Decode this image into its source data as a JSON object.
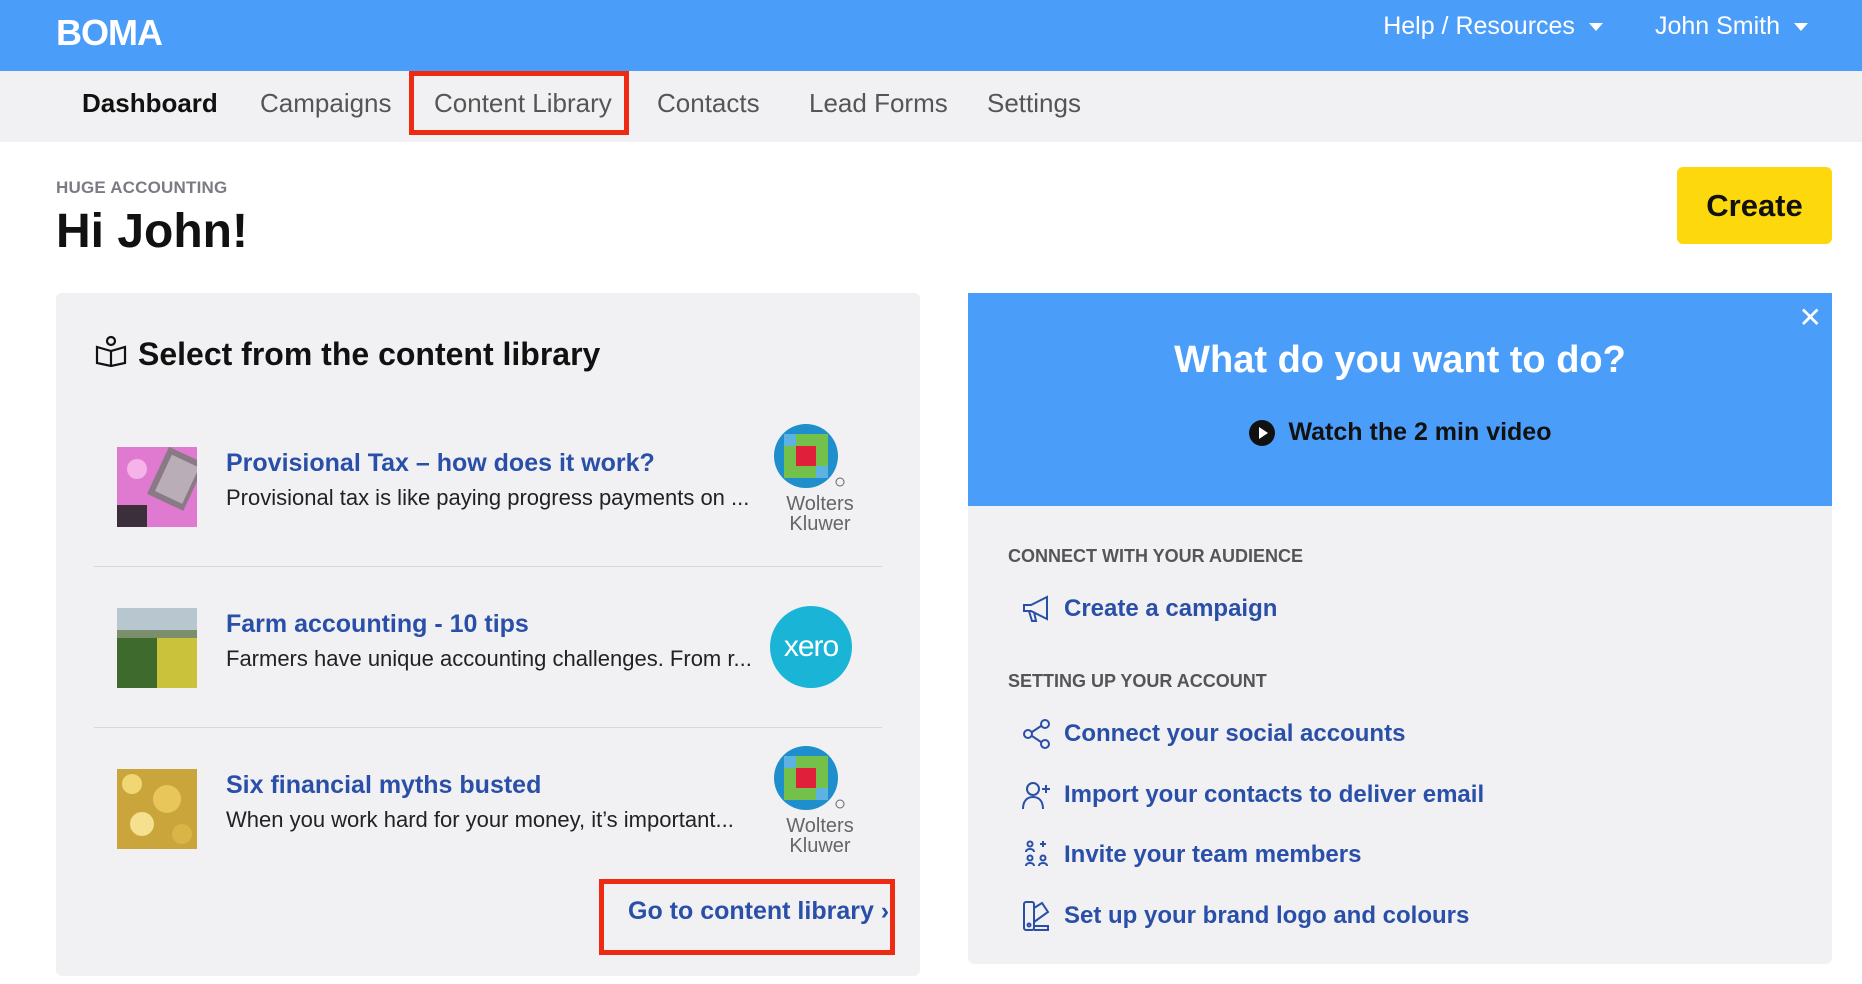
{
  "brand": "BOMA",
  "top_menu": {
    "help": "Help / Resources",
    "user": "John Smith"
  },
  "nav": {
    "tabs": [
      "Dashboard",
      "Campaigns",
      "Content Library",
      "Contacts",
      "Lead Forms",
      "Settings"
    ],
    "active": "Dashboard"
  },
  "header": {
    "org": "HUGE ACCOUNTING",
    "greeting": "Hi John!",
    "create": "Create"
  },
  "library": {
    "title": "Select from the content library",
    "items": [
      {
        "title": "Provisional Tax – how does it work?",
        "desc": "Provisional tax is like paying progress payments on ...",
        "source": "Wolters Kluwer",
        "source_label_1": "Wolters",
        "source_label_2": "Kluwer"
      },
      {
        "title": "Farm accounting - 10 tips",
        "desc": "Farmers have unique accounting challenges. From r...",
        "source": "xero"
      },
      {
        "title": "Six financial myths busted",
        "desc": "When you work hard for your money, it’s important...",
        "source": "Wolters Kluwer",
        "source_label_1": "Wolters",
        "source_label_2": "Kluwer"
      }
    ],
    "go_link": "Go to content library ›"
  },
  "todo": {
    "title": "What do you want to do?",
    "watch": "Watch the 2 min video",
    "section_connect": "CONNECT WITH YOUR AUDIENCE",
    "create_campaign": "Create a campaign",
    "section_setup": "SETTING UP YOUR ACCOUNT",
    "setup_actions": [
      "Connect your social accounts",
      "Import your contacts to deliver email",
      "Invite your team members",
      "Set up your brand logo and colours"
    ]
  },
  "colors": {
    "brand_blue": "#4a9efa",
    "link_blue": "#2a4fa8",
    "create_yellow": "#fcd80d",
    "highlight_red": "#ee2a12",
    "xero_blue": "#1ab4d7"
  }
}
